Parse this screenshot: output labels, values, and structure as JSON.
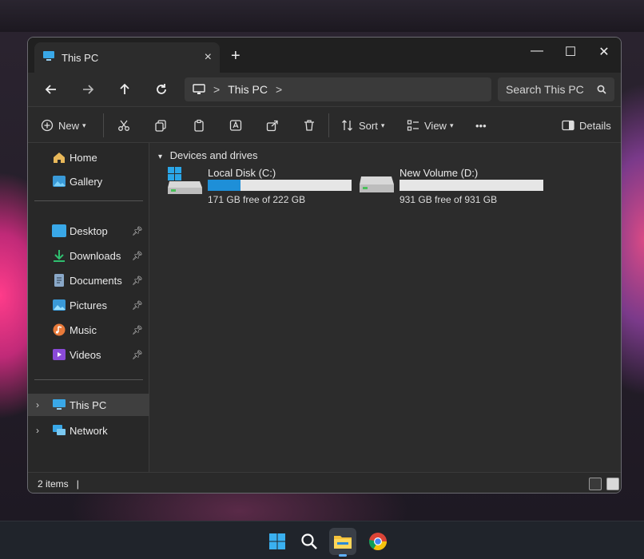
{
  "window": {
    "tab_title": "This PC",
    "new_tab_symbol": "+",
    "close_tab_symbol": "×",
    "minimize_symbol": "—",
    "maximize_symbol": "☐",
    "close_symbol": "✕"
  },
  "nav": {
    "back_icon": "arrow-left-icon",
    "forward_icon": "arrow-right-icon",
    "up_icon": "arrow-up-icon",
    "refresh_icon": "refresh-icon",
    "address": {
      "location": "This PC",
      "separator": ">"
    },
    "search": {
      "placeholder": "Search This PC"
    }
  },
  "toolbar": {
    "new_label": "New",
    "sort_label": "Sort",
    "view_label": "View",
    "more_label": "•••",
    "details_label": "Details"
  },
  "sidebar": {
    "home": "Home",
    "gallery": "Gallery",
    "quick_access": [
      {
        "label": "Desktop",
        "color": "#39a8e8"
      },
      {
        "label": "Downloads",
        "color": "#2fbf6f"
      },
      {
        "label": "Documents",
        "color": "#8aa8c8"
      },
      {
        "label": "Pictures",
        "color": "#3a9ad8"
      },
      {
        "label": "Music",
        "color": "#e87a3a"
      },
      {
        "label": "Videos",
        "color": "#8a4ad8"
      }
    ],
    "this_pc": "This PC",
    "network": "Network"
  },
  "content": {
    "group_title": "Devices and drives",
    "drives": [
      {
        "name": "Local Disk (C:)",
        "free_text": "171 GB free of 222 GB",
        "used_fraction": 0.23
      },
      {
        "name": "New Volume (D:)",
        "free_text": "931 GB free of 931 GB",
        "used_fraction": 0.0
      }
    ]
  },
  "status": {
    "items": "2 items",
    "cursor": "|"
  },
  "colors": {
    "accent": "#1e8fd8",
    "window_bg": "#2c2c2c"
  }
}
